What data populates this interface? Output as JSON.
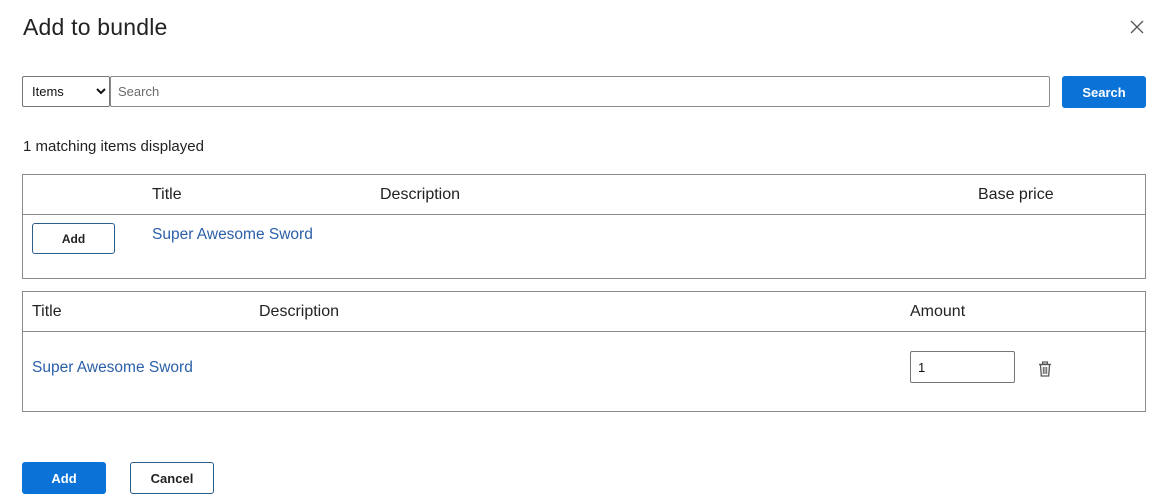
{
  "dialog": {
    "title": "Add to bundle",
    "close_icon": "close-icon"
  },
  "search": {
    "type_selected": "Items",
    "type_options": [
      "Items"
    ],
    "placeholder": "Search",
    "value": "",
    "button_label": "Search"
  },
  "results": {
    "count_text": "1 matching items displayed",
    "columns": [
      "Title",
      "Description",
      "Base price"
    ],
    "rows": [
      {
        "action_label": "Add",
        "title": "Super Awesome Sword",
        "description": "",
        "base_price": ""
      }
    ]
  },
  "bundle": {
    "columns": [
      "Title",
      "Description",
      "Amount"
    ],
    "rows": [
      {
        "title": "Super Awesome Sword",
        "description": "",
        "amount": "1",
        "delete_icon": "trash-icon"
      }
    ]
  },
  "footer": {
    "add_label": "Add",
    "cancel_label": "Cancel"
  },
  "colors": {
    "primary": "#0b73d8",
    "link": "#2b5fa8",
    "border": "#8a8a8a"
  }
}
